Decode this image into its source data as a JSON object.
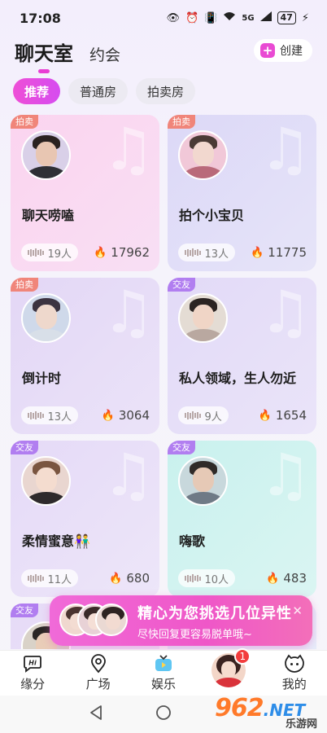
{
  "status_bar": {
    "time": "17:08",
    "network": "5G",
    "battery": "47"
  },
  "header": {
    "tabs": [
      "聊天室",
      "约会"
    ],
    "create_label": "创建"
  },
  "filters": [
    "推荐",
    "普通房",
    "拍卖房"
  ],
  "rooms": [
    {
      "tag": "拍卖",
      "tag_type": "auction",
      "name": "聊天唠嗑",
      "people": "19人",
      "heat": "17962",
      "bg": "linear-gradient(135deg,#fbd4ef,#f8dff4)",
      "skin": "#e8c6b2",
      "hair": "#2a2220",
      "cloth": "#2e2f35",
      "ring": "#d9d0e8"
    },
    {
      "tag": "拍卖",
      "tag_type": "auction",
      "name": "拍个小宝贝",
      "people": "13人",
      "heat": "11775",
      "bg": "linear-gradient(135deg,#dcd8f7,#e6e4f8)",
      "skin": "#f2d8cf",
      "hair": "#4a3a35",
      "cloth": "#b96a7a",
      "ring": "#f1c8d8"
    },
    {
      "tag": "拍卖",
      "tag_type": "auction",
      "name": "倒计时",
      "people": "13人",
      "heat": "3064",
      "bg": "linear-gradient(135deg,#e3d7f6,#ebe3f8)",
      "skin": "#eed8cc",
      "hair": "#3b3340",
      "cloth": "#d8dfe8",
      "ring": "#cfd9ea"
    },
    {
      "tag": "交友",
      "tag_type": "friend",
      "name": "私人领域，生人勿近",
      "people": "9人",
      "heat": "1654",
      "bg": "linear-gradient(135deg,#e2daf7,#eae4f9)",
      "skin": "#f0d5c6",
      "hair": "#2b2422",
      "cloth": "#b9a8a0",
      "ring": "#e4dcd4"
    },
    {
      "tag": "交友",
      "tag_type": "friend",
      "name": "柔情蜜意👫",
      "people": "11人",
      "heat": "680",
      "bg": "linear-gradient(135deg,#e5daf7,#ede6f9)",
      "skin": "#f4dccf",
      "hair": "#7a5540",
      "cloth": "#2e2a2c",
      "ring": "#e9d6d0"
    },
    {
      "tag": "交友",
      "tag_type": "friend",
      "name": "嗨歌",
      "people": "10人",
      "heat": "483",
      "bg": "linear-gradient(135deg,#c9f1ee,#daf5f2)",
      "skin": "#e6c9b6",
      "hair": "#2f2a28",
      "cloth": "#6f7a86",
      "ring": "#c8d8dc"
    }
  ],
  "partial_row": {
    "tag": "交友"
  },
  "promo": {
    "title": "精心为您挑选几位异性",
    "subtitle": "尽快回复更容易脱单哦~"
  },
  "bottom_nav": {
    "items": [
      {
        "label": "缘分",
        "icon": "hi-bubble-icon"
      },
      {
        "label": "广场",
        "icon": "location-pin-icon"
      },
      {
        "label": "娱乐",
        "icon": "tv-icon"
      },
      {
        "label": "",
        "icon": "avatar"
      },
      {
        "label": "我的",
        "icon": "face-icon"
      }
    ],
    "badge": "1"
  },
  "watermark": {
    "num": "962",
    "net": ".NET",
    "cn": "乐游网"
  },
  "colors": {
    "accent": "#e93cd4",
    "auction_tag": "#f0857a",
    "friend_tag": "#b17ef0",
    "fire": "#ff6a3a"
  }
}
